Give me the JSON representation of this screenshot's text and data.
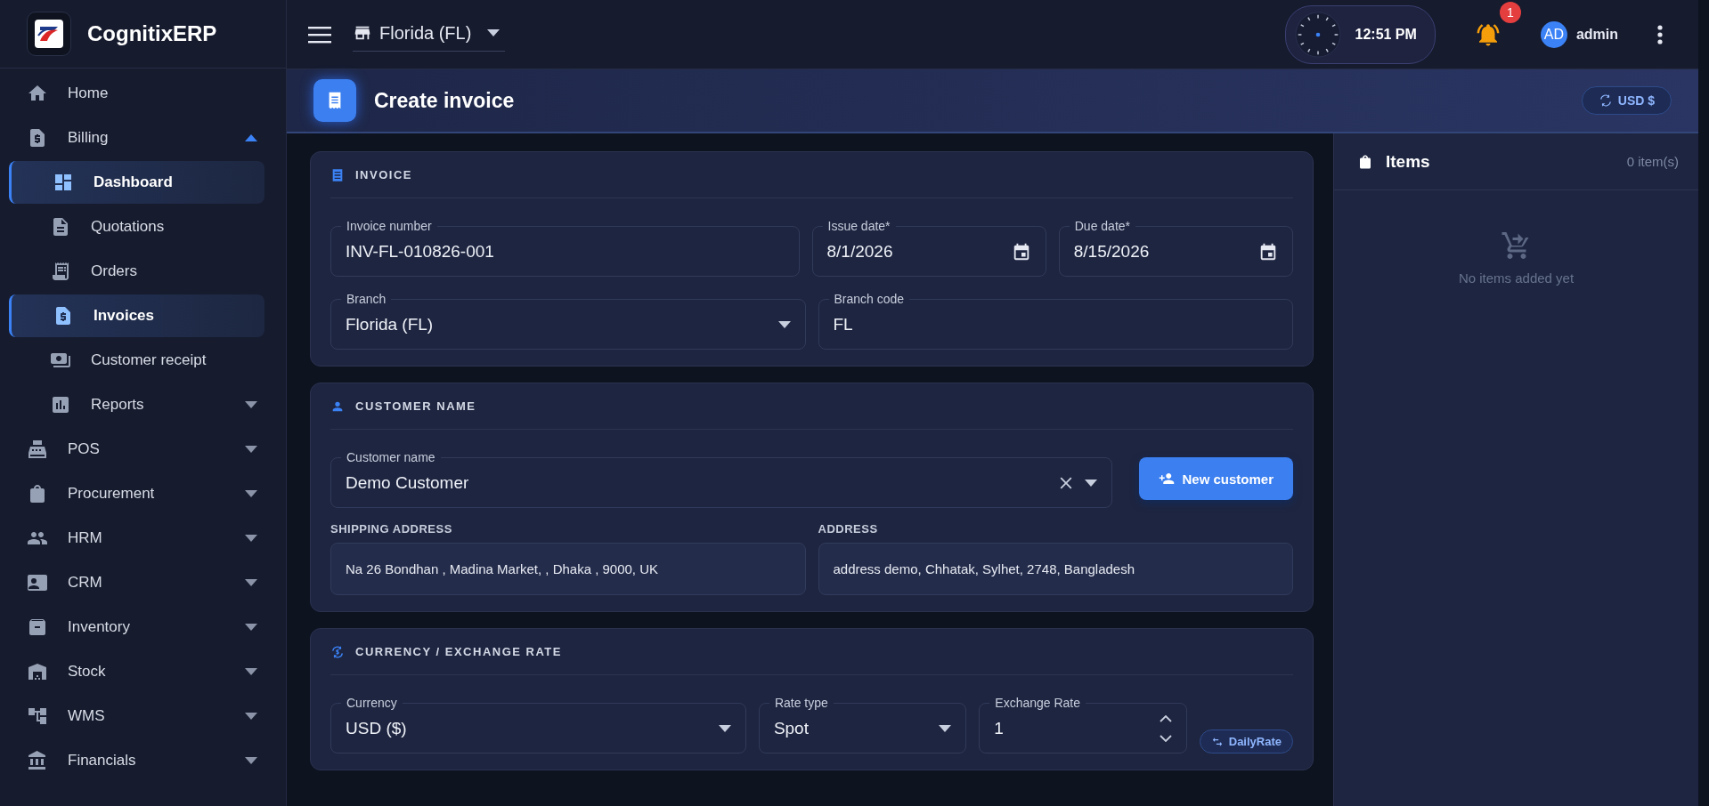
{
  "sidebar": {
    "brand": "CognitixERP",
    "items": [
      {
        "label": "Home",
        "selected": false
      },
      {
        "label": "Billing",
        "selected": false,
        "expanded": true,
        "children": [
          {
            "label": "Dashboard",
            "selected": true
          },
          {
            "label": "Quotations",
            "selected": false
          },
          {
            "label": "Orders",
            "selected": false
          },
          {
            "label": "Invoices",
            "selected": true
          },
          {
            "label": "Customer receipt",
            "selected": false
          },
          {
            "label": "Reports",
            "selected": false,
            "expanded": false
          }
        ]
      },
      {
        "label": "POS",
        "selected": false,
        "expanded": false
      },
      {
        "label": "Procurement",
        "selected": false,
        "expanded": false
      },
      {
        "label": "HRM",
        "selected": false,
        "expanded": false
      },
      {
        "label": "CRM",
        "selected": false,
        "expanded": false
      },
      {
        "label": "Inventory",
        "selected": false,
        "expanded": false
      },
      {
        "label": "Stock",
        "selected": false,
        "expanded": false
      },
      {
        "label": "WMS",
        "selected": false,
        "expanded": false
      },
      {
        "label": "Financials",
        "selected": false,
        "expanded": false
      }
    ]
  },
  "topbar": {
    "branch": "Florida (FL)",
    "time": "12:51 PM",
    "notifications": "1",
    "user_initials": "AD",
    "user_name": "admin"
  },
  "page_header": {
    "title": "Create invoice",
    "currency": "USD $"
  },
  "sections": [
    {
      "kind": "invoice",
      "title": "INVOICE",
      "rows": [
        [
          {
            "kind": "text",
            "label": "Invoice number",
            "value": "INV-FL-010826-001"
          },
          {
            "kind": "date",
            "label": "Issue date*",
            "value": "8/1/2026"
          },
          {
            "kind": "date",
            "label": "Due date*",
            "value": "8/15/2026"
          }
        ],
        [
          {
            "kind": "select",
            "label": "Branch",
            "value": "Florida (FL)"
          },
          {
            "kind": "text",
            "label": "Branch code",
            "value": "FL"
          }
        ]
      ]
    },
    {
      "kind": "customer",
      "title": "CUSTOMER NAME",
      "field": {
        "kind": "combo",
        "label": "Customer name",
        "value": "Demo Customer"
      },
      "button": "New customer",
      "addresses": [
        {
          "label": "SHIPPING ADDRESS",
          "value": "Na 26 Bondhan , Madina Market, , Dhaka , 9000, UK"
        },
        {
          "label": "ADDRESS",
          "value": "address demo, Chhatak, Sylhet, 2748, Bangladesh"
        }
      ]
    },
    {
      "kind": "currency",
      "title": "CURRENCY / EXCHANGE RATE",
      "rows": [
        [
          {
            "kind": "select",
            "label": "Currency",
            "value": "USD ($)"
          },
          {
            "kind": "select",
            "label": "Rate type",
            "value": "Spot"
          },
          {
            "kind": "number",
            "label": "Exchange Rate",
            "value": "1"
          }
        ]
      ],
      "button": "DailyRate"
    }
  ],
  "items_panel": {
    "title": "Items",
    "count": "0 item(s)",
    "empty": "No items added yet"
  }
}
